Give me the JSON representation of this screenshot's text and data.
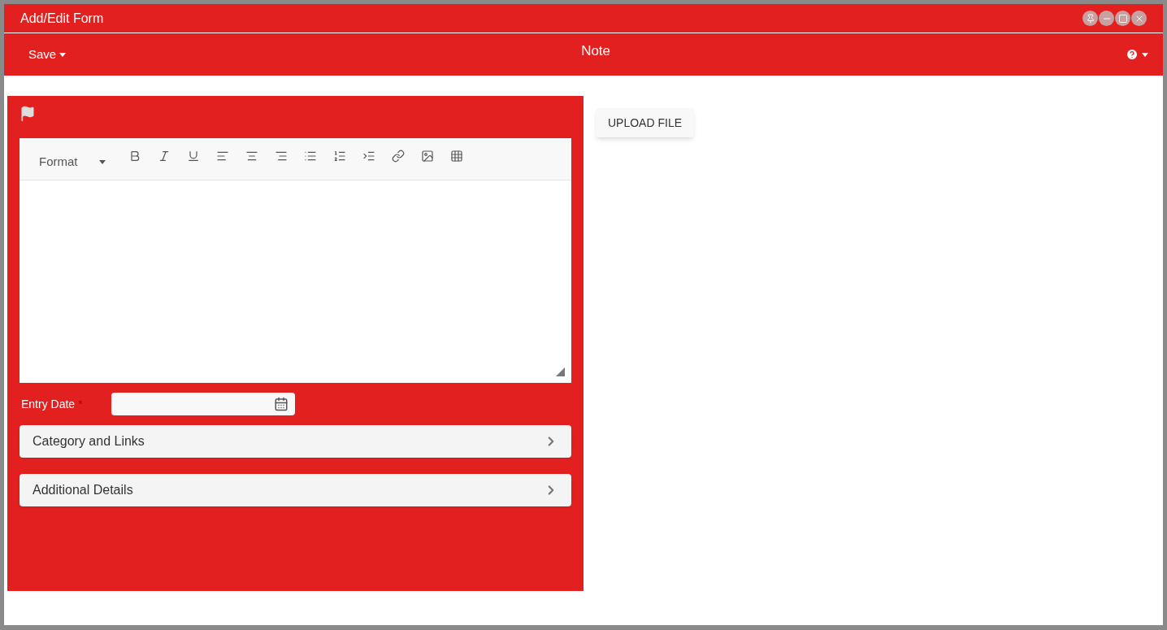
{
  "window": {
    "title": "Add/Edit Form"
  },
  "toolbar": {
    "save_label": "Save",
    "title": "Note"
  },
  "editor": {
    "format_label": "Format"
  },
  "entry_date": {
    "label": "Entry Date",
    "required": true,
    "required_mark": "*"
  },
  "sections": [
    {
      "label": "Category and Links",
      "expanded": false
    },
    {
      "label": "Additional Details",
      "expanded": false
    }
  ],
  "upload_button": "UPLOAD FILE"
}
